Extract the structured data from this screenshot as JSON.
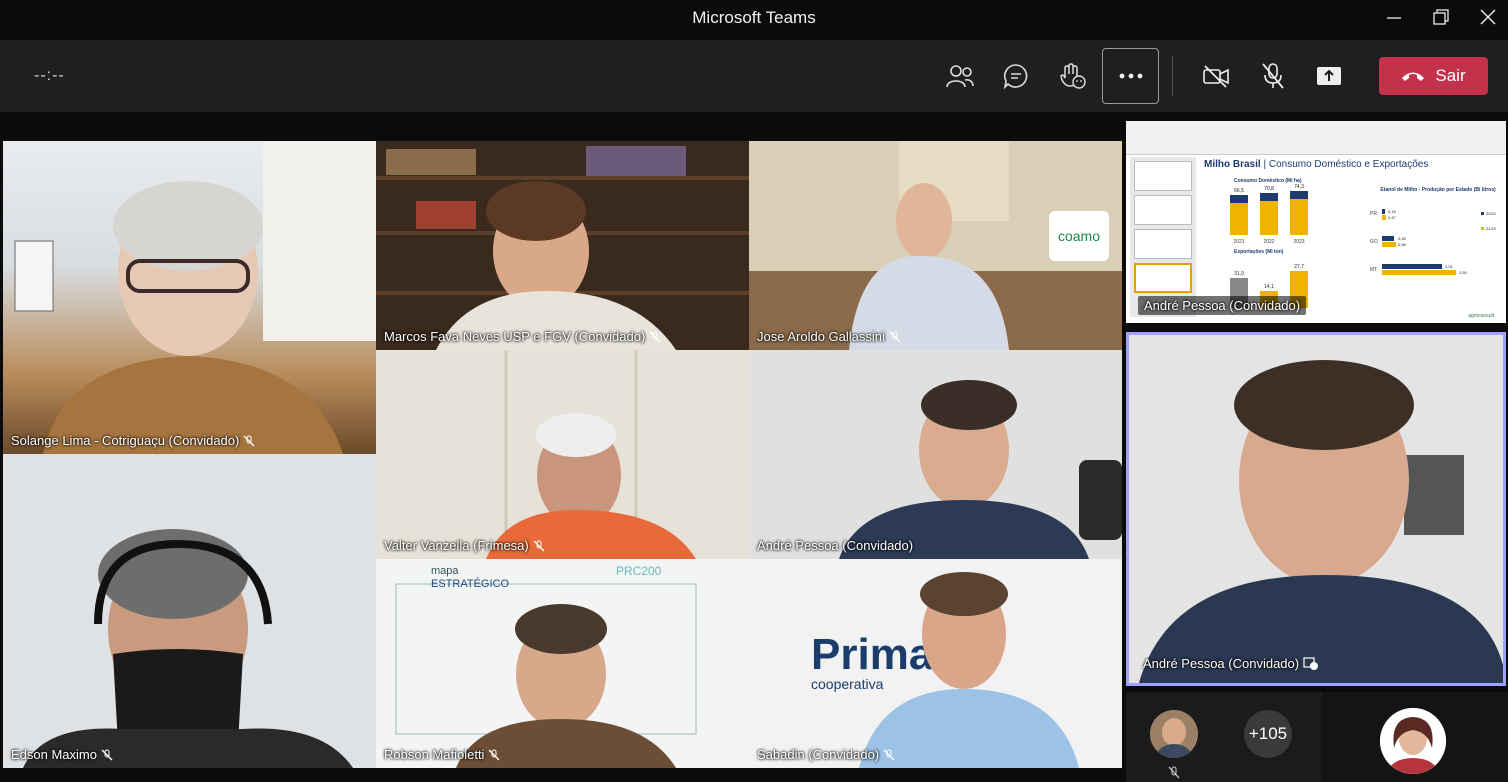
{
  "window": {
    "title": "Microsoft Teams"
  },
  "toolbar": {
    "timer": "--:--",
    "leave_label": "Sair",
    "colors": {
      "leave": "#c4314b",
      "toolbar_bg": "#1f1f1f"
    },
    "icons": [
      "participants-icon",
      "chat-icon",
      "reactions-icon",
      "more-icon",
      "camera-off-icon",
      "mic-off-icon",
      "share-icon",
      "phone-hangup-icon"
    ]
  },
  "grid": [
    {
      "name": "Solange Lima - Cotriguaçu (Convidado)",
      "muted": true
    },
    {
      "name": "Marcos Fava Neves USP e FGV (Convidado)",
      "muted": true
    },
    {
      "name": "Jose Aroldo Gallassini",
      "muted": true
    },
    {
      "name": "Valter Vanzella (Frimesa)",
      "muted": true
    },
    {
      "name": "André Pessoa (Convidado)",
      "muted": false
    },
    {
      "name": "Edson Maximo",
      "muted": true
    },
    {
      "name": "Robson Mafioletti",
      "muted": true
    },
    {
      "name": "Sabadin (Convidado)",
      "muted": true
    }
  ],
  "right": {
    "share_name": "André Pessoa (Convidado)",
    "pinned_name": "André Pessoa (Convidado)",
    "overflow_count": "+105",
    "slide": {
      "title": "Milho Brasil",
      "subtitle": "Consumo Doméstico e Exportações",
      "chart1_title": "Consumo Doméstico (Mi ha)",
      "chart2_title": "Exportações (Mi ton)",
      "chart3_title": "Etanol de Milho - Produção por Estado (Bi litros)",
      "bars_top": [
        "66,5",
        "70,8",
        "74,3"
      ],
      "years": [
        "2021",
        "2022",
        "2023"
      ],
      "exp_values": [
        "31,9",
        "14,1",
        "27,7"
      ],
      "states": [
        "PR",
        "GO",
        "MT"
      ],
      "state_values": [
        "0,15",
        "0,47",
        "0,45",
        "0,58",
        "2,01",
        "2,50"
      ],
      "legend": [
        "20/21",
        "21/22"
      ],
      "brand": "agroconsult"
    }
  }
}
